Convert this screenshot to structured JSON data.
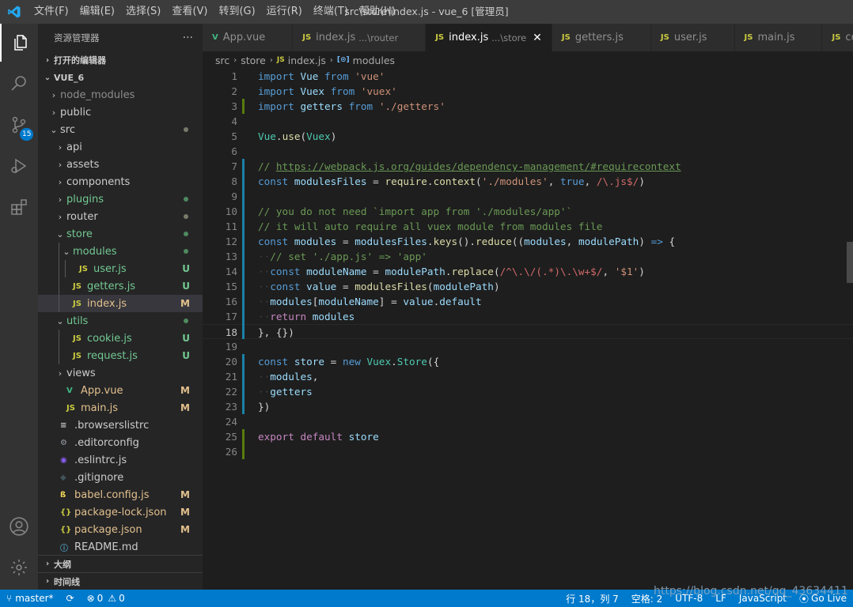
{
  "titlebar": {
    "menus": [
      "文件(F)",
      "编辑(E)",
      "选择(S)",
      "查看(V)",
      "转到(G)",
      "运行(R)",
      "终端(T)",
      "帮助(H)"
    ],
    "title": "src\\store\\index.js - vue_6 [管理员]"
  },
  "activity": {
    "source_control_badge": "15"
  },
  "sidebar": {
    "header": "资源管理器",
    "more": "···",
    "open_editors": "打开的编辑器",
    "project": "VUE_6",
    "outline": "大纲",
    "timeline": "时间线",
    "tree": [
      {
        "label": "node_modules",
        "twisty": "›",
        "icon": "",
        "status": "",
        "color": "#8c8c8c"
      },
      {
        "label": "public",
        "twisty": "›",
        "icon": "",
        "status": "",
        "color": "#cccccc"
      },
      {
        "label": "src",
        "twisty": "⌄",
        "icon": "",
        "status": "dot",
        "color": "#cccccc"
      },
      {
        "label": "api",
        "twisty": "›",
        "icon": "",
        "status": "",
        "color": "#cccccc"
      },
      {
        "label": "assets",
        "twisty": "›",
        "icon": "",
        "status": "",
        "color": "#cccccc"
      },
      {
        "label": "components",
        "twisty": "›",
        "icon": "",
        "status": "",
        "color": "#cccccc"
      },
      {
        "label": "plugins",
        "twisty": "›",
        "icon": "",
        "status": "dot",
        "color": "#73c991"
      },
      {
        "label": "router",
        "twisty": "›",
        "icon": "",
        "status": "dot",
        "color": "#cccccc"
      },
      {
        "label": "store",
        "twisty": "⌄",
        "icon": "",
        "status": "dot",
        "color": "#73c991"
      },
      {
        "label": "modules",
        "twisty": "⌄",
        "icon": "",
        "status": "dot",
        "color": "#73c991"
      },
      {
        "label": "user.js",
        "twisty": "",
        "icon": "JS",
        "status": "U",
        "color": "#73c991"
      },
      {
        "label": "getters.js",
        "twisty": "",
        "icon": "JS",
        "status": "U",
        "color": "#73c991"
      },
      {
        "label": "index.js",
        "twisty": "",
        "icon": "JS",
        "status": "M",
        "color": "#e2c08d"
      },
      {
        "label": "utils",
        "twisty": "⌄",
        "icon": "",
        "status": "dot",
        "color": "#73c991"
      },
      {
        "label": "cookie.js",
        "twisty": "",
        "icon": "JS",
        "status": "U",
        "color": "#73c991"
      },
      {
        "label": "request.js",
        "twisty": "",
        "icon": "JS",
        "status": "U",
        "color": "#73c991"
      },
      {
        "label": "views",
        "twisty": "›",
        "icon": "",
        "status": "",
        "color": "#cccccc"
      },
      {
        "label": "App.vue",
        "twisty": "",
        "icon": "V",
        "status": "M",
        "color": "#e2c08d"
      },
      {
        "label": "main.js",
        "twisty": "",
        "icon": "JS",
        "status": "M",
        "color": "#e2c08d"
      },
      {
        "label": ".browserslistrc",
        "twisty": "",
        "icon": "≡",
        "status": "",
        "color": "#cccccc"
      },
      {
        "label": ".editorconfig",
        "twisty": "",
        "icon": "⚙",
        "status": "",
        "color": "#cccccc"
      },
      {
        "label": ".eslintrc.js",
        "twisty": "",
        "icon": "◉",
        "status": "",
        "color": "#cccccc"
      },
      {
        "label": ".gitignore",
        "twisty": "",
        "icon": "◆",
        "status": "",
        "color": "#cccccc"
      },
      {
        "label": "babel.config.js",
        "twisty": "",
        "icon": "ß",
        "status": "M",
        "color": "#e2c08d"
      },
      {
        "label": "package-lock.json",
        "twisty": "",
        "icon": "{}",
        "status": "M",
        "color": "#e2c08d"
      },
      {
        "label": "package.json",
        "twisty": "",
        "icon": "{}",
        "status": "M",
        "color": "#e2c08d"
      },
      {
        "label": "README.md",
        "twisty": "",
        "icon": "ⓘ",
        "status": "",
        "color": "#cccccc"
      }
    ]
  },
  "tabs": [
    {
      "icon": "V",
      "label": "App.vue",
      "desc": ""
    },
    {
      "icon": "JS",
      "label": "index.js",
      "desc": "...\\router"
    },
    {
      "icon": "JS",
      "label": "index.js",
      "desc": "...\\store",
      "active": true
    },
    {
      "icon": "JS",
      "label": "getters.js",
      "desc": ""
    },
    {
      "icon": "JS",
      "label": "user.js",
      "desc": ""
    },
    {
      "icon": "JS",
      "label": "main.js",
      "desc": ""
    },
    {
      "icon": "JS",
      "label": "co",
      "desc": ""
    }
  ],
  "breadcrumb": {
    "p1": "src",
    "p2": "store",
    "p3": "index.js",
    "p4": "modules",
    "p3_icon": "JS",
    "p4_icon": "[⊙]"
  },
  "editor": {
    "line_numbers": [
      "1",
      "2",
      "3",
      "4",
      "5",
      "6",
      "7",
      "8",
      "9",
      "10",
      "11",
      "12",
      "13",
      "14",
      "15",
      "16",
      "17",
      "18",
      "19",
      "20",
      "21",
      "22",
      "23",
      "24",
      "25",
      "26"
    ],
    "current_line": 18,
    "lines": [
      [
        [
          "k",
          "import"
        ],
        [
          "",
          " "
        ],
        [
          "v",
          "Vue"
        ],
        [
          "",
          " "
        ],
        [
          "k",
          "from"
        ],
        [
          "",
          " "
        ],
        [
          "s",
          "'vue'"
        ]
      ],
      [
        [
          "k",
          "import"
        ],
        [
          "",
          " "
        ],
        [
          "v",
          "Vuex"
        ],
        [
          "",
          " "
        ],
        [
          "k",
          "from"
        ],
        [
          "",
          " "
        ],
        [
          "s",
          "'vuex'"
        ]
      ],
      [
        [
          "k",
          "import"
        ],
        [
          "",
          " "
        ],
        [
          "v",
          "getters"
        ],
        [
          "",
          " "
        ],
        [
          "k",
          "from"
        ],
        [
          "",
          " "
        ],
        [
          "s",
          "'./getters'"
        ]
      ],
      [],
      [
        [
          "t",
          "Vue"
        ],
        [
          "",
          "."
        ],
        [
          "f",
          "use"
        ],
        [
          "",
          "("
        ],
        [
          "t",
          "Vuex"
        ],
        [
          "",
          ")"
        ]
      ],
      [],
      [
        [
          "c",
          "// "
        ],
        [
          "cu",
          "https://webpack.js.org/guides/dependency-management/#requirecontext"
        ]
      ],
      [
        [
          "k",
          "const"
        ],
        [
          "",
          " "
        ],
        [
          "v",
          "modulesFiles"
        ],
        [
          "",
          " = "
        ],
        [
          "f",
          "require"
        ],
        [
          "",
          "."
        ],
        [
          "f",
          "context"
        ],
        [
          "",
          "("
        ],
        [
          "s",
          "'./modules'"
        ],
        [
          "",
          ", "
        ],
        [
          "k",
          "true"
        ],
        [
          "",
          ", "
        ],
        [
          "r",
          "/\\.js$/"
        ],
        [
          "",
          ")"
        ]
      ],
      [],
      [
        [
          "c",
          "// you do not need `import app from './modules/app'`"
        ]
      ],
      [
        [
          "c",
          "// it will auto require all vuex module from modules file"
        ]
      ],
      [
        [
          "k",
          "const"
        ],
        [
          "",
          " "
        ],
        [
          "v",
          "modules"
        ],
        [
          "",
          " = "
        ],
        [
          "v",
          "modulesFiles"
        ],
        [
          "",
          "."
        ],
        [
          "f",
          "keys"
        ],
        [
          "",
          "()."
        ],
        [
          "f",
          "reduce"
        ],
        [
          "",
          "(("
        ],
        [
          "v",
          "modules"
        ],
        [
          "",
          ", "
        ],
        [
          "v",
          "modulePath"
        ],
        [
          "",
          ") "
        ],
        [
          "k",
          "=>"
        ],
        [
          "",
          " {"
        ]
      ],
      [
        [
          "wsguide",
          "··"
        ],
        [
          "c",
          "// set './app.js' => 'app'"
        ]
      ],
      [
        [
          "wsguide",
          "··"
        ],
        [
          "k",
          "const"
        ],
        [
          "",
          " "
        ],
        [
          "v",
          "moduleName"
        ],
        [
          "",
          " = "
        ],
        [
          "v",
          "modulePath"
        ],
        [
          "",
          "."
        ],
        [
          "f",
          "replace"
        ],
        [
          "",
          "("
        ],
        [
          "r",
          "/^\\.\\/(.*)\\.\\w+$/"
        ],
        [
          "",
          ", "
        ],
        [
          "s",
          "'$1'"
        ],
        [
          "",
          ")"
        ]
      ],
      [
        [
          "wsguide",
          "··"
        ],
        [
          "k",
          "const"
        ],
        [
          "",
          " "
        ],
        [
          "v",
          "value"
        ],
        [
          "",
          " = "
        ],
        [
          "f",
          "modulesFiles"
        ],
        [
          "",
          "("
        ],
        [
          "v",
          "modulePath"
        ],
        [
          "",
          ")"
        ]
      ],
      [
        [
          "wsguide",
          "··"
        ],
        [
          "v",
          "modules"
        ],
        [
          "",
          "["
        ],
        [
          "v",
          "moduleName"
        ],
        [
          "",
          "] = "
        ],
        [
          "v",
          "value"
        ],
        [
          "",
          "."
        ],
        [
          "v",
          "default"
        ]
      ],
      [
        [
          "wsguide",
          "··"
        ],
        [
          "kc",
          "return"
        ],
        [
          "",
          " "
        ],
        [
          "v",
          "modules"
        ]
      ],
      [
        [
          "",
          "}, {})"
        ]
      ],
      [],
      [
        [
          "k",
          "const"
        ],
        [
          "",
          " "
        ],
        [
          "v",
          "store"
        ],
        [
          "",
          " = "
        ],
        [
          "k",
          "new"
        ],
        [
          "",
          " "
        ],
        [
          "t",
          "Vuex"
        ],
        [
          "",
          "."
        ],
        [
          "t",
          "Store"
        ],
        [
          "",
          "({"
        ]
      ],
      [
        [
          "wsguide",
          "··"
        ],
        [
          "v",
          "modules"
        ],
        [
          "",
          ","
        ]
      ],
      [
        [
          "wsguide",
          "··"
        ],
        [
          "v",
          "getters"
        ]
      ],
      [
        [
          "",
          "})"
        ]
      ],
      [],
      [
        [
          "kc",
          "export"
        ],
        [
          "",
          " "
        ],
        [
          "kc",
          "default"
        ],
        [
          "",
          " "
        ],
        [
          "v",
          "store"
        ]
      ],
      []
    ],
    "gutter_marks": [
      {
        "line": 3,
        "color": "#587c0c"
      },
      {
        "line": 7,
        "color": "#1b81a8"
      },
      {
        "line": 8,
        "color": "#1b81a8"
      },
      {
        "line": 9,
        "color": "#1b81a8"
      },
      {
        "line": 10,
        "color": "#1b81a8"
      },
      {
        "line": 11,
        "color": "#1b81a8"
      },
      {
        "line": 12,
        "color": "#1b81a8"
      },
      {
        "line": 13,
        "color": "#1b81a8"
      },
      {
        "line": 14,
        "color": "#1b81a8"
      },
      {
        "line": 15,
        "color": "#1b81a8"
      },
      {
        "line": 16,
        "color": "#1b81a8"
      },
      {
        "line": 17,
        "color": "#1b81a8"
      },
      {
        "line": 18,
        "color": "#1b81a8"
      },
      {
        "line": 20,
        "color": "#1b81a8"
      },
      {
        "line": 21,
        "color": "#1b81a8"
      },
      {
        "line": 22,
        "color": "#1b81a8"
      },
      {
        "line": 23,
        "color": "#1b81a8"
      },
      {
        "line": 25,
        "color": "#587c0c"
      },
      {
        "line": 26,
        "color": "#587c0c"
      }
    ]
  },
  "statusbar": {
    "branch": "master*",
    "sync_icon": "⟳",
    "errors": "0",
    "warnings": "0",
    "position": "行 18，列 7",
    "spaces": "空格: 2",
    "encoding": "UTF-8",
    "eol": "LF",
    "language": "JavaScript",
    "golive": "Go Live"
  },
  "watermark": "https://blog.csdn.net/qq_43634411",
  "colors": {
    "accent": "#007acc",
    "titlebar": "#3c3c3c",
    "activitybar": "#333333",
    "sidebar": "#252526",
    "editor": "#1e1e1e",
    "untracked": "#73c991",
    "modified": "#e2c08d"
  }
}
